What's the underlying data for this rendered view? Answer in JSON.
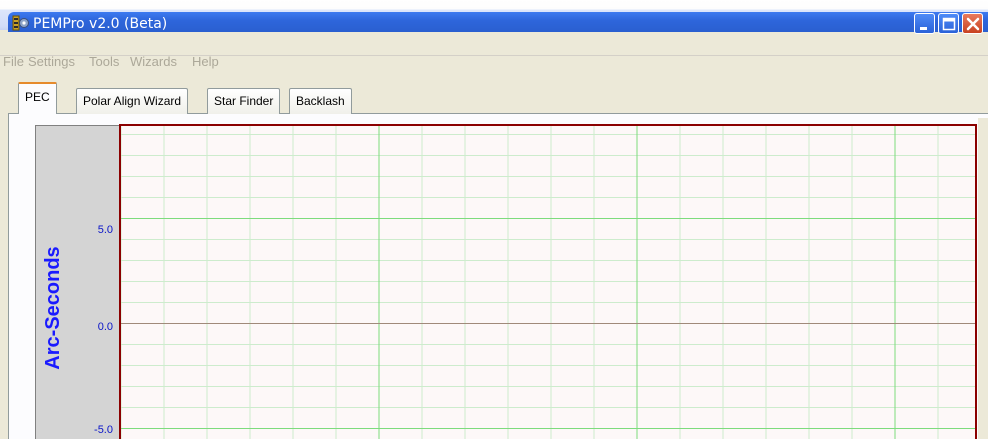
{
  "window": {
    "title": "PEMPro v2.0 (Beta)"
  },
  "menu": {
    "items": [
      "File",
      "Settings",
      "Tools",
      "Wizards",
      "Help"
    ]
  },
  "tabs": [
    {
      "label": "PEC",
      "active": true
    },
    {
      "label": "Polar Align Wizard",
      "active": false
    },
    {
      "label": "Star Finder",
      "active": false
    },
    {
      "label": "Backlash",
      "active": false
    }
  ],
  "chart_data": {
    "type": "line",
    "ylabel": "Arc-Seconds",
    "yticks": [
      "5.0",
      "0.0",
      "-5.0"
    ],
    "ylim": [
      -5.6,
      9.4
    ],
    "series": [],
    "grid": true,
    "colors": {
      "frame": "#8b0000",
      "major_grid": "#7ddc7d",
      "minor_grid": "#cdeccd",
      "zero_line": "#a08a7a",
      "tick_label": "#0a14c8",
      "axis_title": "#1a1aff"
    }
  }
}
